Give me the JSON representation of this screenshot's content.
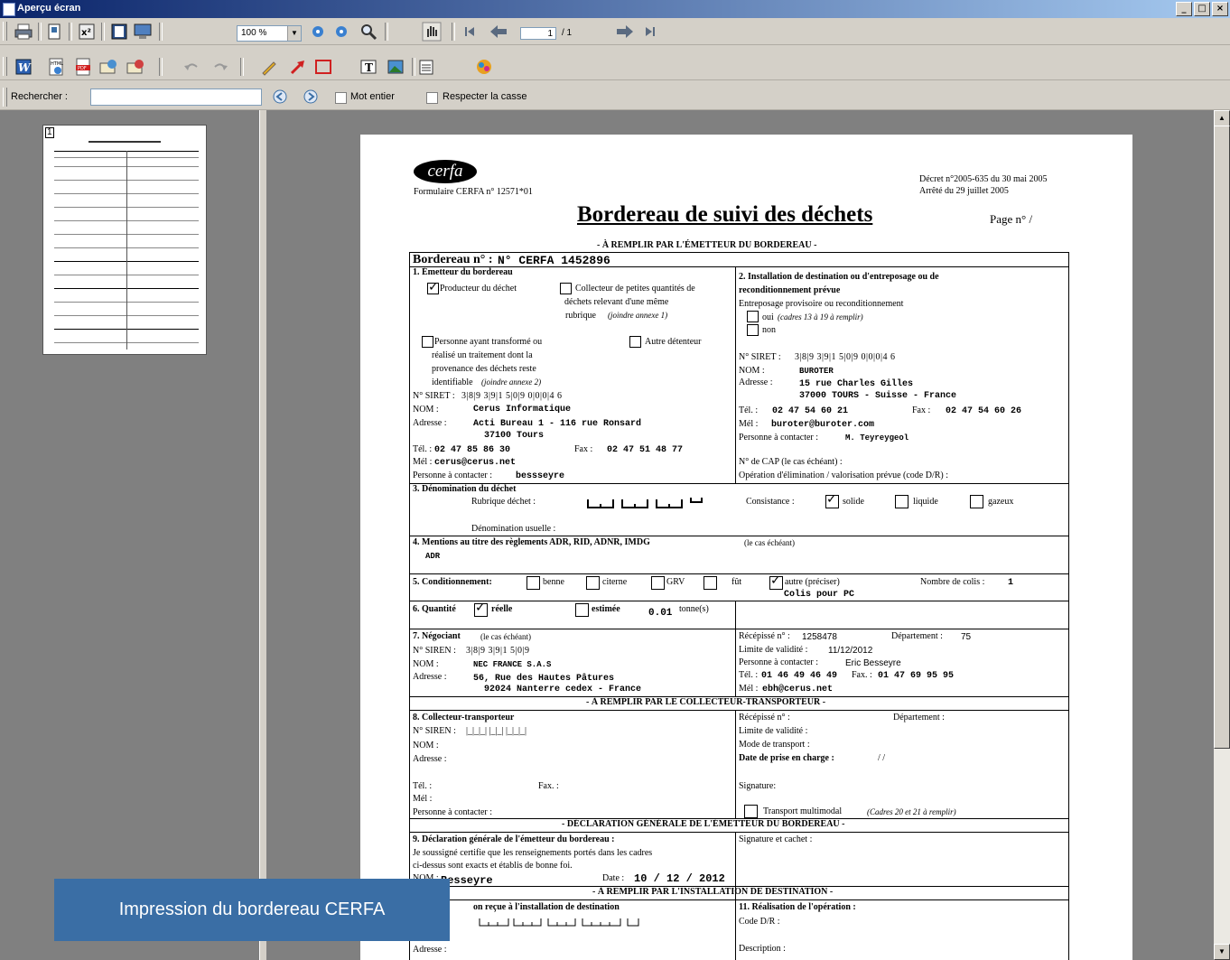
{
  "window": {
    "title": "Aperçu écran",
    "controls": [
      "_",
      "□",
      "×"
    ]
  },
  "toolbar": {
    "zoom_value": "100 %",
    "page_current": "1",
    "page_total": "/ 1"
  },
  "search": {
    "label": "Rechercher :",
    "value": "",
    "whole_word_label": "Mot entier",
    "match_case_label": "Respecter la casse"
  },
  "thumbnail": {
    "page_number": "1"
  },
  "document": {
    "logo": "cerfa",
    "form_number": "Formulaire CERFA n° 12571*01",
    "decree": "Décret n°2005-635 du 30 mai 2005",
    "arrete": "Arrêté du 29 juillet 2005",
    "title": "Bordereau de suivi des déchets",
    "page_label": "Page n°   /",
    "section_emitter_header": "- À REMPLIR PAR L'ÉMETTEUR DU BORDEREAU -",
    "bordereau_label": "Bordereau n° :",
    "bordereau_value": "N° CERFA 1452896",
    "s1": {
      "title": "1. Émetteur du bordereau",
      "producteur": "Producteur du déchet",
      "collecteur_line1": "Collecteur de petites quantités de",
      "collecteur_line2": "déchets relevant d'une même",
      "collecteur_line3": "rubrique",
      "collecteur_note": "(joindre annexe 1)",
      "personne_line1": "Personne ayant transformé ou",
      "personne_line2": "réalisé un traitement dont la",
      "personne_line3": "provenance des déchets reste",
      "personne_line4": "identifiable",
      "personne_note": "(joindre annexe 2)",
      "autre": "Autre détenteur",
      "siret_label": "N° SIRET :",
      "siret_value": "3|8|9  3|9|1  5|0|9  0|0|0|4  6",
      "nom_label": "NOM :",
      "nom_value": "Cerus Informatique",
      "adresse_label": "Adresse :",
      "adresse_value1": "Acti Bureau 1 - 116 rue Ronsard",
      "adresse_value2": "37100 Tours",
      "tel_label": "Tél. :",
      "tel_value": "02 47 85 86 30",
      "fax_label": "Fax :",
      "fax_value": "02 47 51 48 77",
      "mel_label": "Mél :",
      "mel_value": "cerus@cerus.net",
      "contact_label": "Personne à contacter :",
      "contact_value": "bessseyre"
    },
    "s2": {
      "title1": "2. Installation de destination ou d'entreposage ou de",
      "title2": "reconditionnement prévue",
      "entreposage": "Entreposage provisoire ou reconditionnement",
      "oui": "oui",
      "oui_note": "(cadres 13 à 19 à remplir)",
      "non": "non",
      "siret_label": "N° SIRET :",
      "siret_value": "3|8|9  3|9|1  5|0|9  0|0|0|4  6",
      "nom_label": "NOM :",
      "nom_value": "BUROTER",
      "adresse_label": "Adresse :",
      "adresse_value1": "15 rue Charles Gilles",
      "adresse_value2": "37000 TOURS - Suisse - France",
      "tel_label": "Tél. :",
      "tel_value": "02 47 54 60 21",
      "fax_label": "Fax :",
      "fax_value": "02 47 54 60 26",
      "mel_label": "Mél :",
      "mel_value": "buroter@buroter.com",
      "contact_label": "Personne à contacter :",
      "contact_value": "M. Teyreygeol",
      "cap": "N° de CAP (le cas échéant) :",
      "operation": "Opération d'élimination / valorisation prévue (code D/R) :"
    },
    "s3": {
      "title": "3. Dénomination du déchet",
      "rubrique": "Rubrique déchet :",
      "consistance": "Consistance :",
      "solide": "solide",
      "liquide": "liquide",
      "gazeux": "gazeux",
      "usuelle": "Dénomination usuelle :"
    },
    "s4": {
      "title": "4. Mentions au titre des règlements ADR, RID, ADNR, IMDG",
      "note": "(le cas échéant)",
      "value": "ADR"
    },
    "s5": {
      "title": "5. Conditionnement:",
      "benne": "benne",
      "citerne": "citerne",
      "grv": "GRV",
      "fut": "fût",
      "autre": "autre (préciser)",
      "autre_value": "Colis pour PC",
      "colis_label": "Nombre de colis :",
      "colis_value": "1"
    },
    "s6": {
      "title": "6. Quantité",
      "reelle": "réelle",
      "estimee": "estimée",
      "value": "0.01",
      "unit": "tonne(s)"
    },
    "s7": {
      "title": "7. Négociant",
      "note": "(le cas échéant)",
      "siren_label": "N° SIREN :",
      "siren_value": "3|8|9  3|9|1  5|0|9",
      "nom_label": "NOM :",
      "nom_value": "NEC FRANCE S.A.S",
      "adresse_label": "Adresse :",
      "adresse_value1": "56, Rue des Hautes Pâtures",
      "adresse_value2": "92024 Nanterre cedex - France",
      "recepisse_label": "Récépissé n° :",
      "recepisse_value": "1258478",
      "departement_label": "Département :",
      "departement_value": "75",
      "validite_label": "Limite de validité :",
      "validite_value": "11/12/2012",
      "contact_label": "Personne à contacter :",
      "contact_value": "Eric Besseyre",
      "tel_label": "Tél. :",
      "tel_value": "01 46 49 46 49",
      "fax_label": "Fax. :",
      "fax_value": "01 47 69 95 95",
      "mel_label": "Mél :",
      "mel_value": "ebh@cerus.net"
    },
    "section_collector_header": "- À REMPLIR PAR LE COLLECTEUR-TRANSPORTEUR -",
    "s8": {
      "title": "8. Collecteur-transporteur",
      "siren_label": "N° SIREN :",
      "siren_value": "|_|_|_|  |_|_|  |_|_|_|",
      "nom_label": "NOM :",
      "adresse_label": "Adresse :",
      "tel_label": "Tél. :",
      "fax_label": "Fax. :",
      "mel_label": "Mél :",
      "contact_label": "Personne à contacter :",
      "recepisse": "Récépissé n° :",
      "departement": "Département :",
      "validite": "Limite de validité :",
      "mode": "Mode de transport :",
      "date_label": "Date de prise en charge :",
      "date_value": "/   /",
      "signature": "Signature:",
      "multimodal": "Transport multimodal",
      "multimodal_note": "(Cadres 20 et 21 à remplir)"
    },
    "section_declaration_header": "- DÉCLARATION GÉNÉRALE DE L'ÉMETTEUR DU BORDEREAU -",
    "s9": {
      "title": "9. Déclaration générale de l'émetteur du bordereau :",
      "text1": "Je soussigné certifie que les renseignements portés dans les cadres",
      "text2": "ci-dessus sont exacts et établis de bonne foi.",
      "nom_label": "NOM :",
      "nom_value": "Besseyre",
      "date_label": "Date :",
      "date_value": "10 / 12 / 2012",
      "signature": "Signature et cachet :"
    },
    "section_installation_header": "- À REMPLIR PAR L'INSTALLATION DE DESTINATION -",
    "s10": {
      "title": "on reçue à l'installation de destination",
      "adresse_label": "Adresse :"
    },
    "s11": {
      "title": "11. Réalisation de l'opération :",
      "code": "Code D/R :",
      "description": "Description :"
    }
  },
  "overlay": {
    "caption": "Impression du bordereau CERFA"
  }
}
